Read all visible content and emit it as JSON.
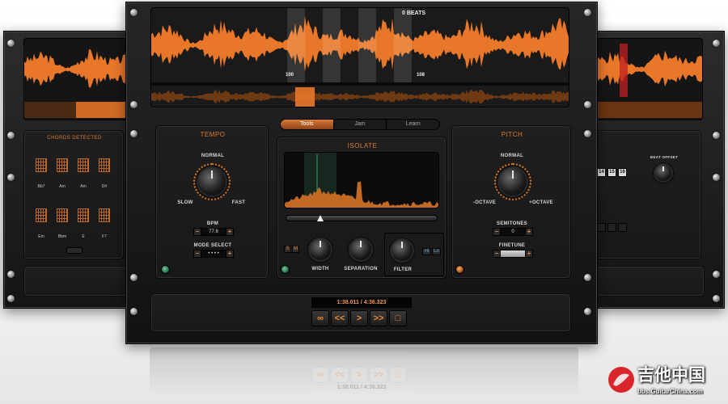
{
  "waveform": {
    "beats_label": "0 BEATS",
    "marker_left": "100",
    "marker_right": "108"
  },
  "tabs": [
    {
      "label": "Tools",
      "active": true
    },
    {
      "label": "Jam",
      "active": false
    },
    {
      "label": "Learn",
      "active": false
    }
  ],
  "tempo": {
    "title": "TEMPO",
    "mode_label": "NORMAL",
    "slow_label": "SLOW",
    "fast_label": "FAST",
    "bpm_label": "BPM",
    "bpm_value": "77.6",
    "mode_select_label": "MODE SELECT",
    "mode_select_value": "• • • •"
  },
  "isolate": {
    "title": "ISOLATE",
    "s_label": "S",
    "m_label": "M",
    "width_label": "WIDTH",
    "separation_label": "SEPARATION",
    "filter_label": "FILTER",
    "hi_label": "Hi",
    "lo_label": "Lo"
  },
  "pitch": {
    "title": "PITCH",
    "mode_label": "NORMAL",
    "minus_label": "-OCTAVE",
    "plus_label": "+OCTAVE",
    "semitones_label": "SEMITONES",
    "semitones_value": "0",
    "finetune_label": "FINETUNE"
  },
  "transport": {
    "time": "1:38.011 / 4:36.323",
    "buttons": [
      "∞",
      "<<",
      ">",
      ">>",
      "□"
    ]
  },
  "left_panel": {
    "chords_title": "CHORDS DETECTED",
    "chords": [
      "Bb7",
      "Am",
      "Am",
      "D#",
      "Em",
      "Bbm",
      "E",
      "F7"
    ]
  },
  "right_panel": {
    "beat_offset_label": "BEAT OFFSET",
    "beat_numbers": [
      "14",
      "15",
      "16"
    ]
  },
  "reflection": {
    "time": "1:38.011 / 4:36.323"
  },
  "watermark": {
    "title": "吉他中国",
    "url": "bbs.GuitarChina.com"
  },
  "colors": {
    "accent": "#e07b2c",
    "waveform": "#e8772a",
    "panel": "#1c1c1c"
  }
}
